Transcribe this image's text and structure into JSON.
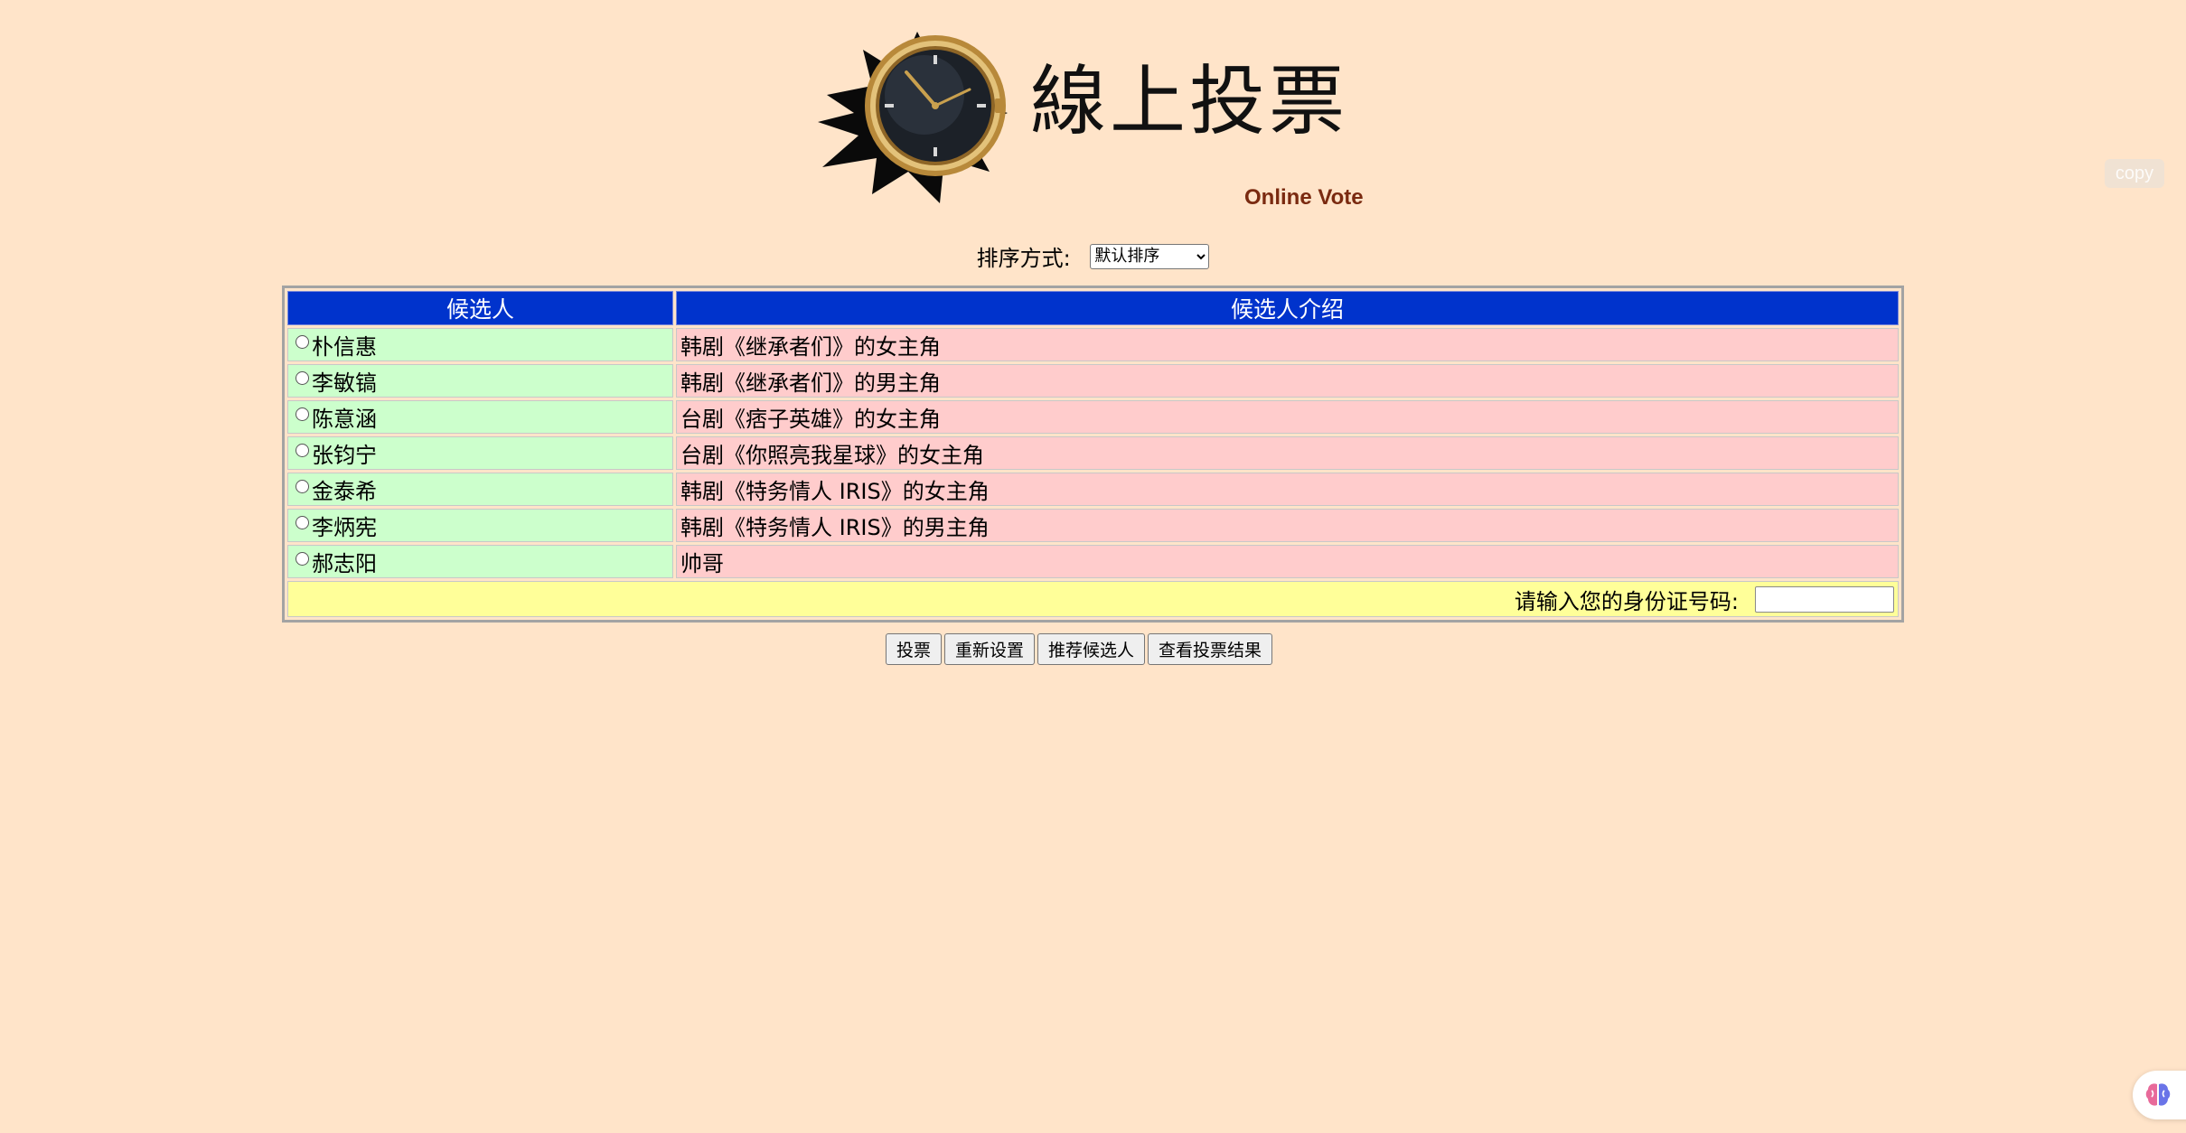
{
  "header": {
    "title": "線上投票",
    "subtitle": "Online Vote"
  },
  "sort": {
    "label": "排序方式:",
    "selected": "默认排序"
  },
  "table": {
    "headers": [
      "候选人",
      "候选人介绍"
    ],
    "rows": [
      {
        "name": "朴信惠",
        "intro": "韩剧《继承者们》的女主角"
      },
      {
        "name": "李敏镐",
        "intro": "韩剧《继承者们》的男主角"
      },
      {
        "name": "陈意涵",
        "intro": "台剧《痞子英雄》的女主角"
      },
      {
        "name": "张钧宁",
        "intro": "台剧《你照亮我星球》的女主角"
      },
      {
        "name": "金泰希",
        "intro": "韩剧《特务情人 IRIS》的女主角"
      },
      {
        "name": "李炳宪",
        "intro": "韩剧《特务情人 IRIS》的男主角"
      },
      {
        "name": "郝志阳",
        "intro": "帅哥"
      }
    ],
    "id_label": "请输入您的身份证号码:",
    "id_value": ""
  },
  "buttons": {
    "vote": "投票",
    "reset": "重新设置",
    "recommend": "推荐候选人",
    "results": "查看投票结果"
  },
  "overlay": {
    "copy_label": "copy",
    "assistant_icon": "brain-icon"
  },
  "colors": {
    "page_bg": "#FFE4C9",
    "header_bg": "#0033CC",
    "name_bg": "#CCFFCC",
    "intro_bg": "#FFCCCC",
    "id_row_bg": "#FFFF99",
    "subtitle": "#7A2A10"
  }
}
